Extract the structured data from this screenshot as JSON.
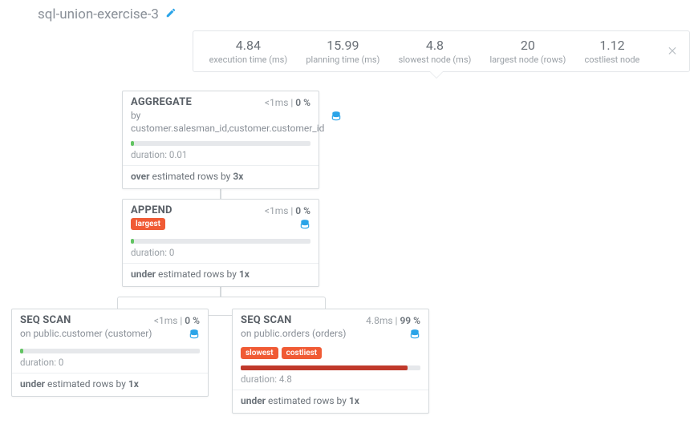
{
  "title": "sql-union-exercise-3",
  "stats": [
    {
      "value": "4.84",
      "label": "execution time (ms)"
    },
    {
      "value": "15.99",
      "label": "planning time (ms)"
    },
    {
      "value": "4.8",
      "label": "slowest node (ms)"
    },
    {
      "value": "20",
      "label": "largest node (rows)"
    },
    {
      "value": "1.12",
      "label": "costliest node"
    }
  ],
  "nodes": {
    "aggregate": {
      "type": "AGGREGATE",
      "time_prefix": "<1",
      "time_unit": "ms",
      "pct": "0",
      "subtext": "by customer.salesman_id,customer.customer_id",
      "duration": "duration: 0.01",
      "est_dir": "over",
      "est_rest": " estimated rows by ",
      "est_factor": "3x"
    },
    "append": {
      "type": "APPEND",
      "time_prefix": "<1",
      "time_unit": "ms",
      "pct": "0",
      "badges": [
        "largest"
      ],
      "duration": "duration: 0",
      "est_dir": "under",
      "est_rest": " estimated rows by ",
      "est_factor": "1x"
    },
    "seqscan1": {
      "type": "SEQ SCAN",
      "time_prefix": "<1",
      "time_unit": "ms",
      "pct": "0",
      "subtext": "on public.customer (customer)",
      "duration": "duration: 0",
      "est_dir": "under",
      "est_rest": " estimated rows by ",
      "est_factor": "1x"
    },
    "seqscan2": {
      "type": "SEQ SCAN",
      "time_prefix": "4.8",
      "time_unit": "ms",
      "pct": "99",
      "subtext": "on public.orders (orders)",
      "badges": [
        "slowest",
        "costliest"
      ],
      "duration": "duration: 4.8",
      "est_dir": "under",
      "est_rest": " estimated rows by ",
      "est_factor": "1x"
    }
  }
}
